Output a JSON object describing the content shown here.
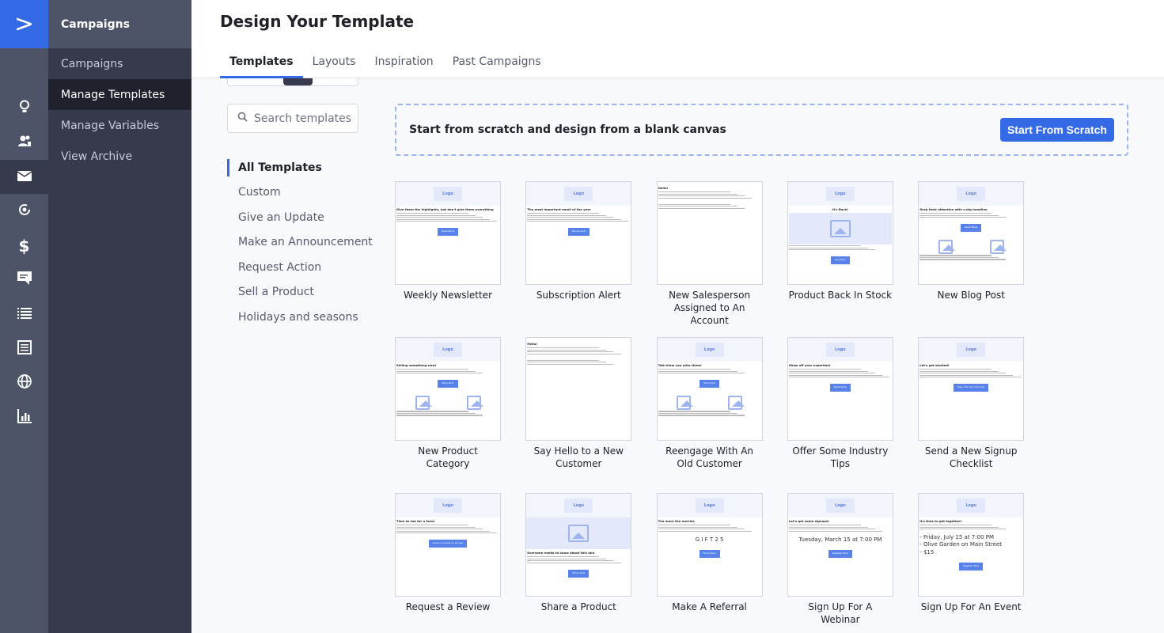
{
  "app": {
    "brand_icon": "chevron-right-logo",
    "colors": {
      "accent": "#356ae6",
      "rail": "#4e5468",
      "submenu": "#363a4c"
    }
  },
  "rail": [
    {
      "icon": "search-icon"
    },
    {
      "icon": "lightbulb-icon"
    },
    {
      "icon": "contacts-icon"
    },
    {
      "icon": "mail-icon",
      "active": true
    },
    {
      "icon": "automation-icon"
    },
    {
      "icon": "dollar-icon"
    },
    {
      "icon": "chat-icon"
    },
    {
      "icon": "list-icon"
    },
    {
      "icon": "forms-icon"
    },
    {
      "icon": "globe-icon"
    },
    {
      "icon": "reports-icon"
    }
  ],
  "submenu": {
    "title": "Campaigns",
    "items": [
      "Campaigns",
      "Manage Templates",
      "Manage Variables",
      "View Archive"
    ],
    "active": 1
  },
  "header": {
    "title": "Design Your Template",
    "tabs": [
      "Templates",
      "Layouts",
      "Inspiration",
      "Past Campaigns"
    ],
    "active_tab": 0
  },
  "search": {
    "placeholder": "Search templates"
  },
  "categories": {
    "items": [
      "All Templates",
      "Custom",
      "Give an Update",
      "Make an Announcement",
      "Request Action",
      "Sell a Product",
      "Holidays and seasons"
    ],
    "active": 0
  },
  "scratch": {
    "text": "Start from scratch and design from a blank canvas",
    "button": "Start From Scratch"
  },
  "templates": [
    {
      "name": "Weekly Newsletter",
      "kind": "text",
      "logo": "Logo",
      "heading": "Give them the highlights, but don't give them everything",
      "button": "Read More"
    },
    {
      "name": "Subscription Alert",
      "kind": "text",
      "logo": "Logo",
      "heading": "The most important email of the year",
      "button": "Renew Now"
    },
    {
      "name": "New Salesperson Assigned to An Account",
      "kind": "plain",
      "heading": "Hello!"
    },
    {
      "name": "Product Back In Stock",
      "kind": "hero",
      "logo": "Logo",
      "heading": "It's Back!",
      "button": "Buy Now"
    },
    {
      "name": "New Blog Post",
      "kind": "two",
      "logo": "Logo",
      "heading": "Grab their attention with a big headline",
      "button": "Read More"
    },
    {
      "name": "New Product Category",
      "kind": "two",
      "logo": "Logo",
      "heading": "Selling something new!",
      "button": "Shop Now"
    },
    {
      "name": "Say Hello to a New Customer",
      "kind": "plain",
      "heading": "Hello!"
    },
    {
      "name": "Reengage With An Old Customer",
      "kind": "two",
      "logo": "Logo",
      "heading": "Talk them you miss them!",
      "button": "Shop Now"
    },
    {
      "name": "Offer Some Industry Tips",
      "kind": "text",
      "logo": "Logo",
      "heading": "Show off your expertise!",
      "button": "Read More"
    },
    {
      "name": "Send a New Signup Checklist",
      "kind": "text",
      "logo": "Logo",
      "heading": "Let's get started!",
      "button": "Sign Into Your Account"
    },
    {
      "name": "Request a Review",
      "kind": "text",
      "logo": "Logo",
      "heading": "Time to ask for a favor",
      "button": "Leave a review on Google"
    },
    {
      "name": "Share a Product",
      "kind": "herotext",
      "logo": "Logo",
      "heading": "Everyone needs to know about this one.",
      "button": "Share Now"
    },
    {
      "name": "Make A Referral",
      "kind": "big",
      "logo": "Logo",
      "heading": "The more the merrier.",
      "big": "G I F T 2 5",
      "button": "Share Now"
    },
    {
      "name": "Sign Up For A Webinar",
      "kind": "big",
      "logo": "Logo",
      "heading": "Let's get some signups!",
      "big": "Tuesday, March 15 at 7:00 PM",
      "button": "Register Now"
    },
    {
      "name": "Sign Up For An Event",
      "kind": "event",
      "logo": "Logo",
      "heading": "It's time to get together!",
      "big_lines": [
        "- Friday, July 15 at 7:00 PM",
        "- Olive Garden on Main Street",
        "- $15"
      ],
      "button": "Register Now"
    }
  ]
}
